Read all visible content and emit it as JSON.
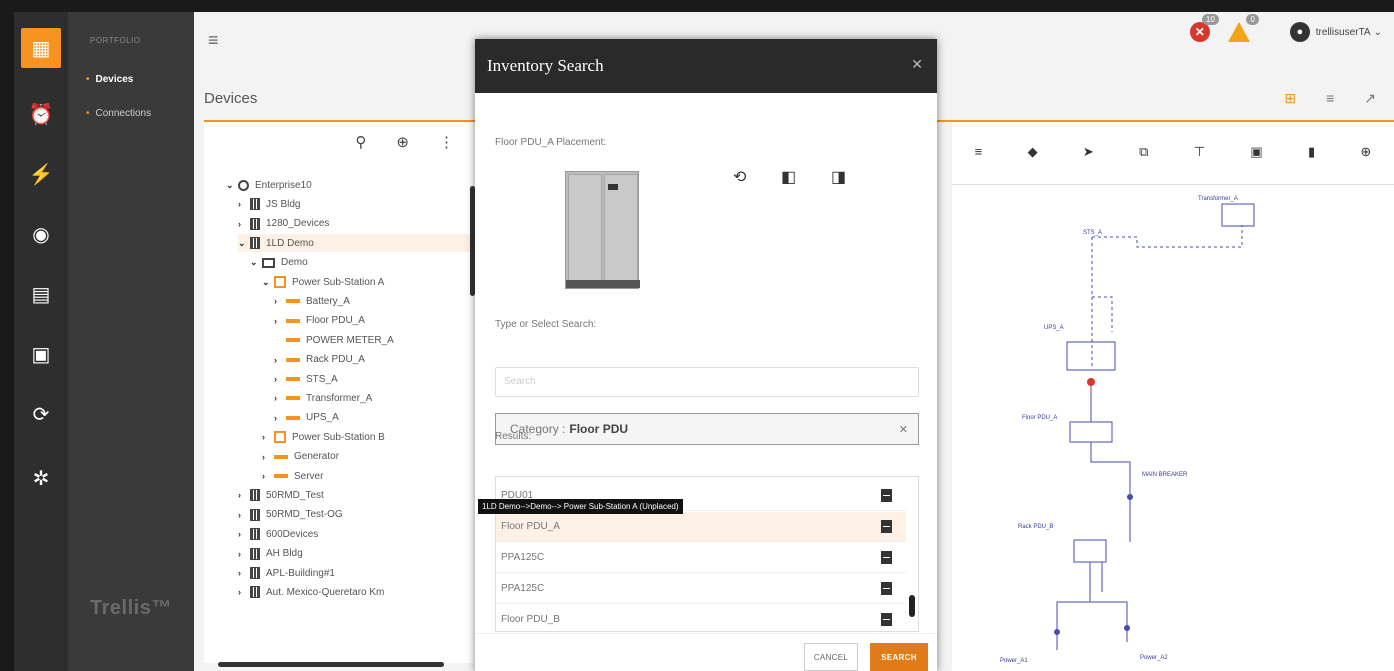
{
  "nav": {
    "title": "PORTFOLIO",
    "items": [
      {
        "label": "Devices",
        "active": true
      },
      {
        "label": "Connections",
        "active": false
      }
    ],
    "brand": "Trellis™"
  },
  "header": {
    "section_title": "Devices",
    "alerts": {
      "critical_count": "10",
      "warning_count": "0"
    },
    "user": "trellisuserTA"
  },
  "tree": {
    "rows": [
      {
        "label": "Enterprise10",
        "arrow": "⌄",
        "kind": "globe",
        "indent": 0
      },
      {
        "label": "JS Bldg",
        "arrow": "›",
        "kind": "building",
        "indent": 1
      },
      {
        "label": "1280_Devices",
        "arrow": "›",
        "kind": "building",
        "indent": 1
      },
      {
        "label": "1LD Demo",
        "arrow": "⌄",
        "kind": "building",
        "indent": 1,
        "selected": true
      },
      {
        "label": "Demo",
        "arrow": "⌄",
        "kind": "demo",
        "indent": 2
      },
      {
        "label": "Power Sub-Station A",
        "arrow": "⌄",
        "kind": "sub",
        "indent": 3
      },
      {
        "label": "Battery_A",
        "arrow": "›",
        "kind": "device",
        "indent": 4
      },
      {
        "label": "Floor PDU_A",
        "arrow": "›",
        "kind": "device",
        "indent": 4
      },
      {
        "label": "POWER METER_A",
        "arrow": "",
        "kind": "device",
        "indent": 4
      },
      {
        "label": "Rack PDU_A",
        "arrow": "›",
        "kind": "device",
        "indent": 4
      },
      {
        "label": "STS_A",
        "arrow": "›",
        "kind": "device",
        "indent": 4
      },
      {
        "label": "Transformer_A",
        "arrow": "›",
        "kind": "device",
        "indent": 4
      },
      {
        "label": "UPS_A",
        "arrow": "›",
        "kind": "device",
        "indent": 4
      },
      {
        "label": "Power Sub-Station B",
        "arrow": "›",
        "kind": "sub",
        "indent": 3
      },
      {
        "label": "Generator",
        "arrow": "›",
        "kind": "device",
        "indent": 3
      },
      {
        "label": "Server",
        "arrow": "›",
        "kind": "device",
        "indent": 3
      },
      {
        "label": "50RMD_Test",
        "arrow": "›",
        "kind": "building",
        "indent": 1
      },
      {
        "label": "50RMD_Test-OG",
        "arrow": "›",
        "kind": "building",
        "indent": 1
      },
      {
        "label": "600Devices",
        "arrow": "›",
        "kind": "building",
        "indent": 1
      },
      {
        "label": "AH Bldg",
        "arrow": "›",
        "kind": "building",
        "indent": 1
      },
      {
        "label": "APL-Building#1",
        "arrow": "›",
        "kind": "building",
        "indent": 1
      },
      {
        "label": "Aut. Mexico-Queretaro Km",
        "arrow": "›",
        "kind": "building",
        "indent": 1
      }
    ]
  },
  "modal": {
    "title": "Inventory Search",
    "placement_label": "Floor PDU_A Placement:",
    "type_label": "Type or Select Search:",
    "search_placeholder": "Search",
    "category_key": "Category :",
    "category_value": "Floor PDU",
    "results_label": "Results:",
    "results": [
      {
        "label": "PDU01",
        "selected": false
      },
      {
        "label": "Floor PDU_A",
        "selected": true
      },
      {
        "label": "PPA125C",
        "selected": false
      },
      {
        "label": "PPA125C",
        "selected": false
      },
      {
        "label": "Floor PDU_B",
        "selected": false
      }
    ],
    "tooltip": "1LD Demo-->Demo--> Power Sub-Station A (Unplaced)",
    "cancel_label": "CANCEL",
    "search_label": "SEARCH"
  },
  "diagram": {
    "labels": [
      "Transformer_A",
      "STS_A",
      "UPS_A",
      "Floor PDU_A",
      "MAIN BREAKER",
      "Rack PDU_B",
      "Power_A1",
      "Power_A2"
    ]
  },
  "colors": {
    "accent": "#f7931e",
    "critical": "#d9362b",
    "warning": "#f5a31a",
    "modal_header": "#2a2a2a"
  }
}
